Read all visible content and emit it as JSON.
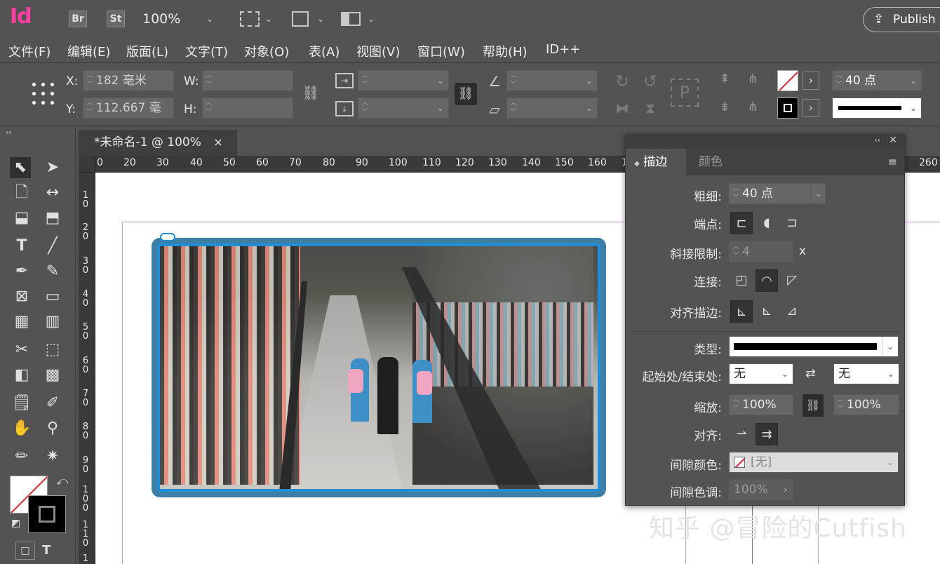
{
  "app": {
    "logo": "Id",
    "bridge": "Br",
    "stock": "St",
    "zoom": "100%",
    "publish": "Publish O"
  },
  "menu": [
    "文件(F)",
    "编辑(E)",
    "版面(L)",
    "文字(T)",
    "对象(O)",
    "表(A)",
    "视图(V)",
    "窗口(W)",
    "帮助(H)",
    "ID++"
  ],
  "control": {
    "x_label": "X:",
    "x_value": "182 毫米",
    "y_label": "Y:",
    "y_value": "112.667 毫",
    "w_label": "W:",
    "h_label": "H:",
    "stroke_weight": "40 点",
    "ref_point_letter": "P"
  },
  "document": {
    "tab_title": "*未命名-1 @ 100%",
    "close": "×"
  },
  "ruler_h": [
    "0",
    "20",
    "30",
    "40",
    "50",
    "60",
    "70",
    "80",
    "90",
    "100",
    "110",
    "120",
    "130",
    "140",
    "150",
    "160",
    "1",
    "260"
  ],
  "ruler_v": [
    "1\n0",
    "2\n0",
    "3\n0",
    "4\n0",
    "5\n0",
    "6\n0",
    "7\n0",
    "8\n0",
    "9\n0",
    "1\n0\n0",
    "1\n1\n0",
    "1"
  ],
  "panel": {
    "tab_stroke": "描边",
    "tab_color": "颜色",
    "weight_label": "粗细:",
    "weight_value": "40 点",
    "cap_label": "端点:",
    "miter_label": "斜接限制:",
    "miter_value": "4",
    "miter_unit": "x",
    "join_label": "连接:",
    "align_label": "对齐描边:",
    "type_label": "类型:",
    "startend_label": "起始处/结束处:",
    "start_value": "无",
    "end_value": "无",
    "scale_label": "缩放:",
    "scale_start": "100%",
    "scale_end": "100%",
    "align2_label": "对齐:",
    "gap_color_label": "间隙颜色:",
    "gap_color_value": "[无]",
    "gap_tint_label": "间隙色调:",
    "gap_tint_value": "100%"
  },
  "watermark": "知乎 @冒险的Cutfish",
  "colors": {
    "frame_stroke": "#1f8ed6",
    "logo": "#ff3fa4"
  }
}
